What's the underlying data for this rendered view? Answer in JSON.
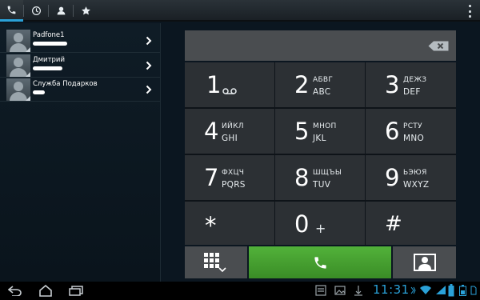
{
  "actionbar": {
    "tabs": [
      {
        "icon": "phone-icon",
        "active": true
      },
      {
        "icon": "clock-icon",
        "active": false
      },
      {
        "icon": "contacts-icon",
        "active": false
      },
      {
        "icon": "star-icon",
        "active": false
      }
    ],
    "overflow_icon": "overflow-menu-icon"
  },
  "contacts": [
    {
      "name": "Padfone1"
    },
    {
      "name": "Дмитрий"
    },
    {
      "name": "Служба Подарков"
    }
  ],
  "dialpad": {
    "keys": [
      {
        "digit": "1",
        "letters_ru": "",
        "letters_en": ""
      },
      {
        "digit": "2",
        "letters_ru": "АБВГ",
        "letters_en": "ABC"
      },
      {
        "digit": "3",
        "letters_ru": "ДЕЖЗ",
        "letters_en": "DEF"
      },
      {
        "digit": "4",
        "letters_ru": "ИЙКЛ",
        "letters_en": "GHI"
      },
      {
        "digit": "5",
        "letters_ru": "МНОП",
        "letters_en": "JKL"
      },
      {
        "digit": "6",
        "letters_ru": "РСТУ",
        "letters_en": "MNO"
      },
      {
        "digit": "7",
        "letters_ru": "ФХЦЧ",
        "letters_en": "PQRS"
      },
      {
        "digit": "8",
        "letters_ru": "ШЩЪЫ",
        "letters_en": "TUV"
      },
      {
        "digit": "9",
        "letters_ru": "ЬЭЮЯ",
        "letters_en": "WXYZ"
      },
      {
        "digit": "*",
        "letters_ru": "",
        "letters_en": ""
      },
      {
        "digit": "0",
        "letters_ru": "",
        "letters_en": "+"
      },
      {
        "digit": "#",
        "letters_ru": "",
        "letters_en": ""
      }
    ]
  },
  "system_bar": {
    "clock": "11:31"
  },
  "colors": {
    "accent": "#2aa1d8",
    "call_green": "#47a530",
    "key_bg": "#2c3034",
    "display_bg": "#4a4d50"
  }
}
